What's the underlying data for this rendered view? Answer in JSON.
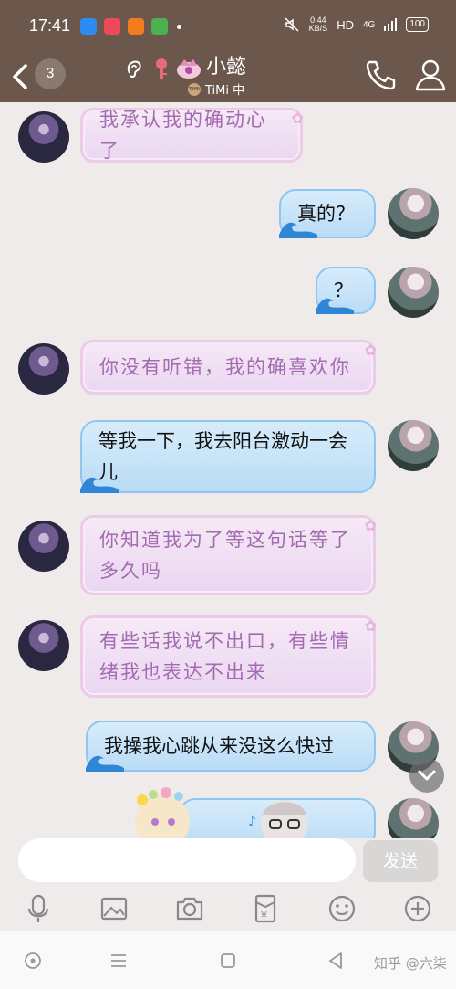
{
  "status_bar": {
    "time": "17:41",
    "net_speed": "0.44",
    "net_unit": "KB/S",
    "hd": "HD",
    "signal": "4G",
    "battery": "100",
    "app_icon_colors": [
      "#2e8cf0",
      "#f04a5a",
      "#f27b1d",
      "#4caf50"
    ]
  },
  "header": {
    "unread_count": "3",
    "contact_name": "小懿",
    "game_status": "TiMi 中",
    "timi_logo": "TiMi"
  },
  "messages": [
    {
      "side": "left",
      "text": "我承认我的确动心了"
    },
    {
      "side": "right",
      "text": "真的？"
    },
    {
      "side": "right",
      "text": "？"
    },
    {
      "side": "left",
      "text": "你没有听错，我的确喜欢你"
    },
    {
      "side": "right",
      "text": "等我一下，我去阳台激动一会儿"
    },
    {
      "side": "left",
      "text": "你知道我为了等这句话等了多久吗"
    },
    {
      "side": "left",
      "text": "有些话我说不出口，有些情绪我也表达不出来"
    },
    {
      "side": "right",
      "text": "我操我心跳从来没这么快过"
    }
  ],
  "input": {
    "placeholder": "",
    "send_label": "发送"
  },
  "toolbar": {
    "icons": [
      "microphone-icon",
      "image-icon",
      "camera-icon",
      "red-packet-icon",
      "emoji-icon",
      "plus-icon"
    ]
  },
  "watermark": "知乎 @六柒",
  "colors": {
    "header_bg": "#6b574b",
    "left_bubble_text": "#a36bb0",
    "right_bubble_bg": "#c5e3f8"
  }
}
